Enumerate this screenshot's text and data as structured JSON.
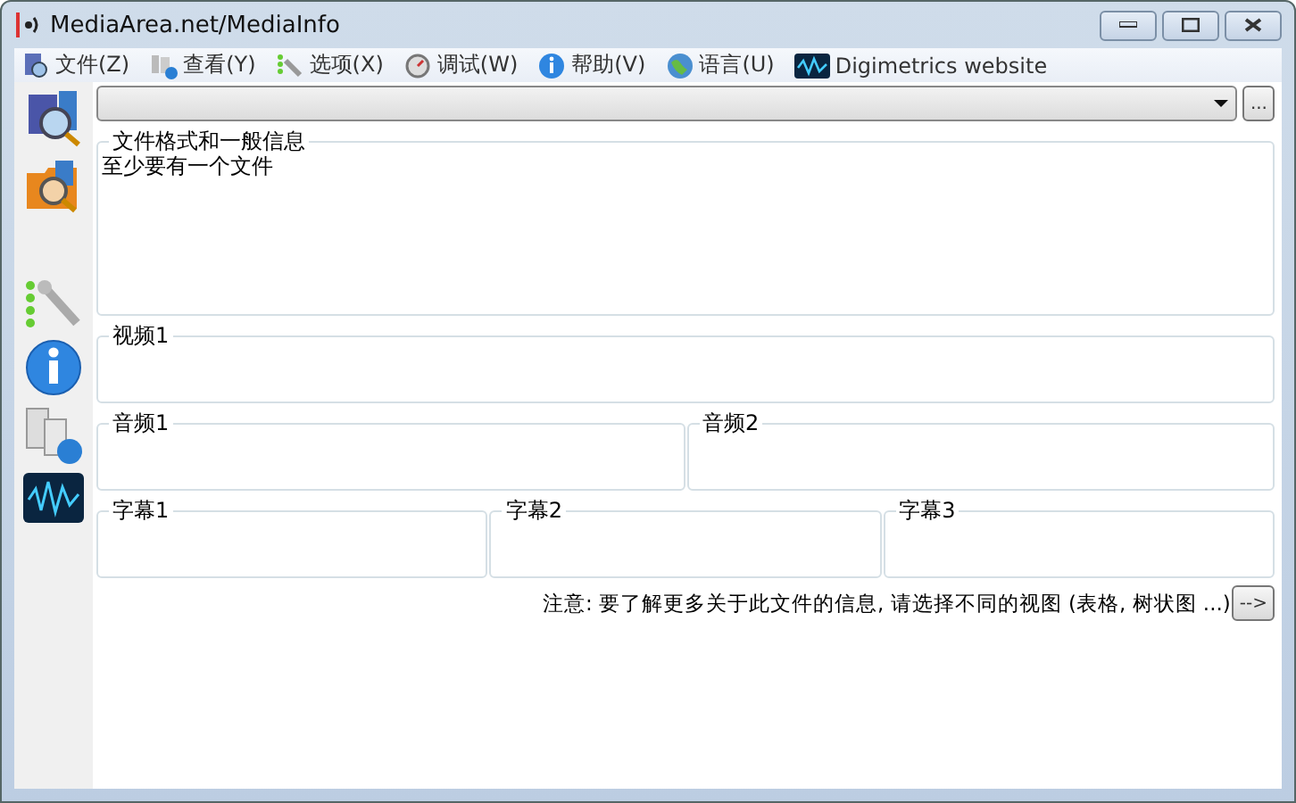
{
  "window": {
    "title": "MediaArea.net/MediaInfo"
  },
  "menu": [
    {
      "label": "文件(Z)"
    },
    {
      "label": "查看(Y)"
    },
    {
      "label": "选项(X)"
    },
    {
      "label": "调试(W)"
    },
    {
      "label": "帮助(V)"
    },
    {
      "label": "语言(U)"
    },
    {
      "label": "Digimetrics website"
    }
  ],
  "file_selector": {
    "button": "..."
  },
  "sections": [
    [
      {
        "title": "文件格式和一般信息",
        "text": "至少要有一个文件"
      }
    ],
    [
      {
        "title": "视频1"
      }
    ],
    [
      {
        "title": "音频1"
      },
      {
        "title": "音频2"
      }
    ],
    [
      {
        "title": "字幕1"
      },
      {
        "title": "字幕2"
      },
      {
        "title": "字幕3"
      }
    ]
  ],
  "note": {
    "text": "注意: 要了解更多关于此文件的信息, 请选择不同的视图 (表格, 树状图 ...)",
    "button": "-->"
  }
}
